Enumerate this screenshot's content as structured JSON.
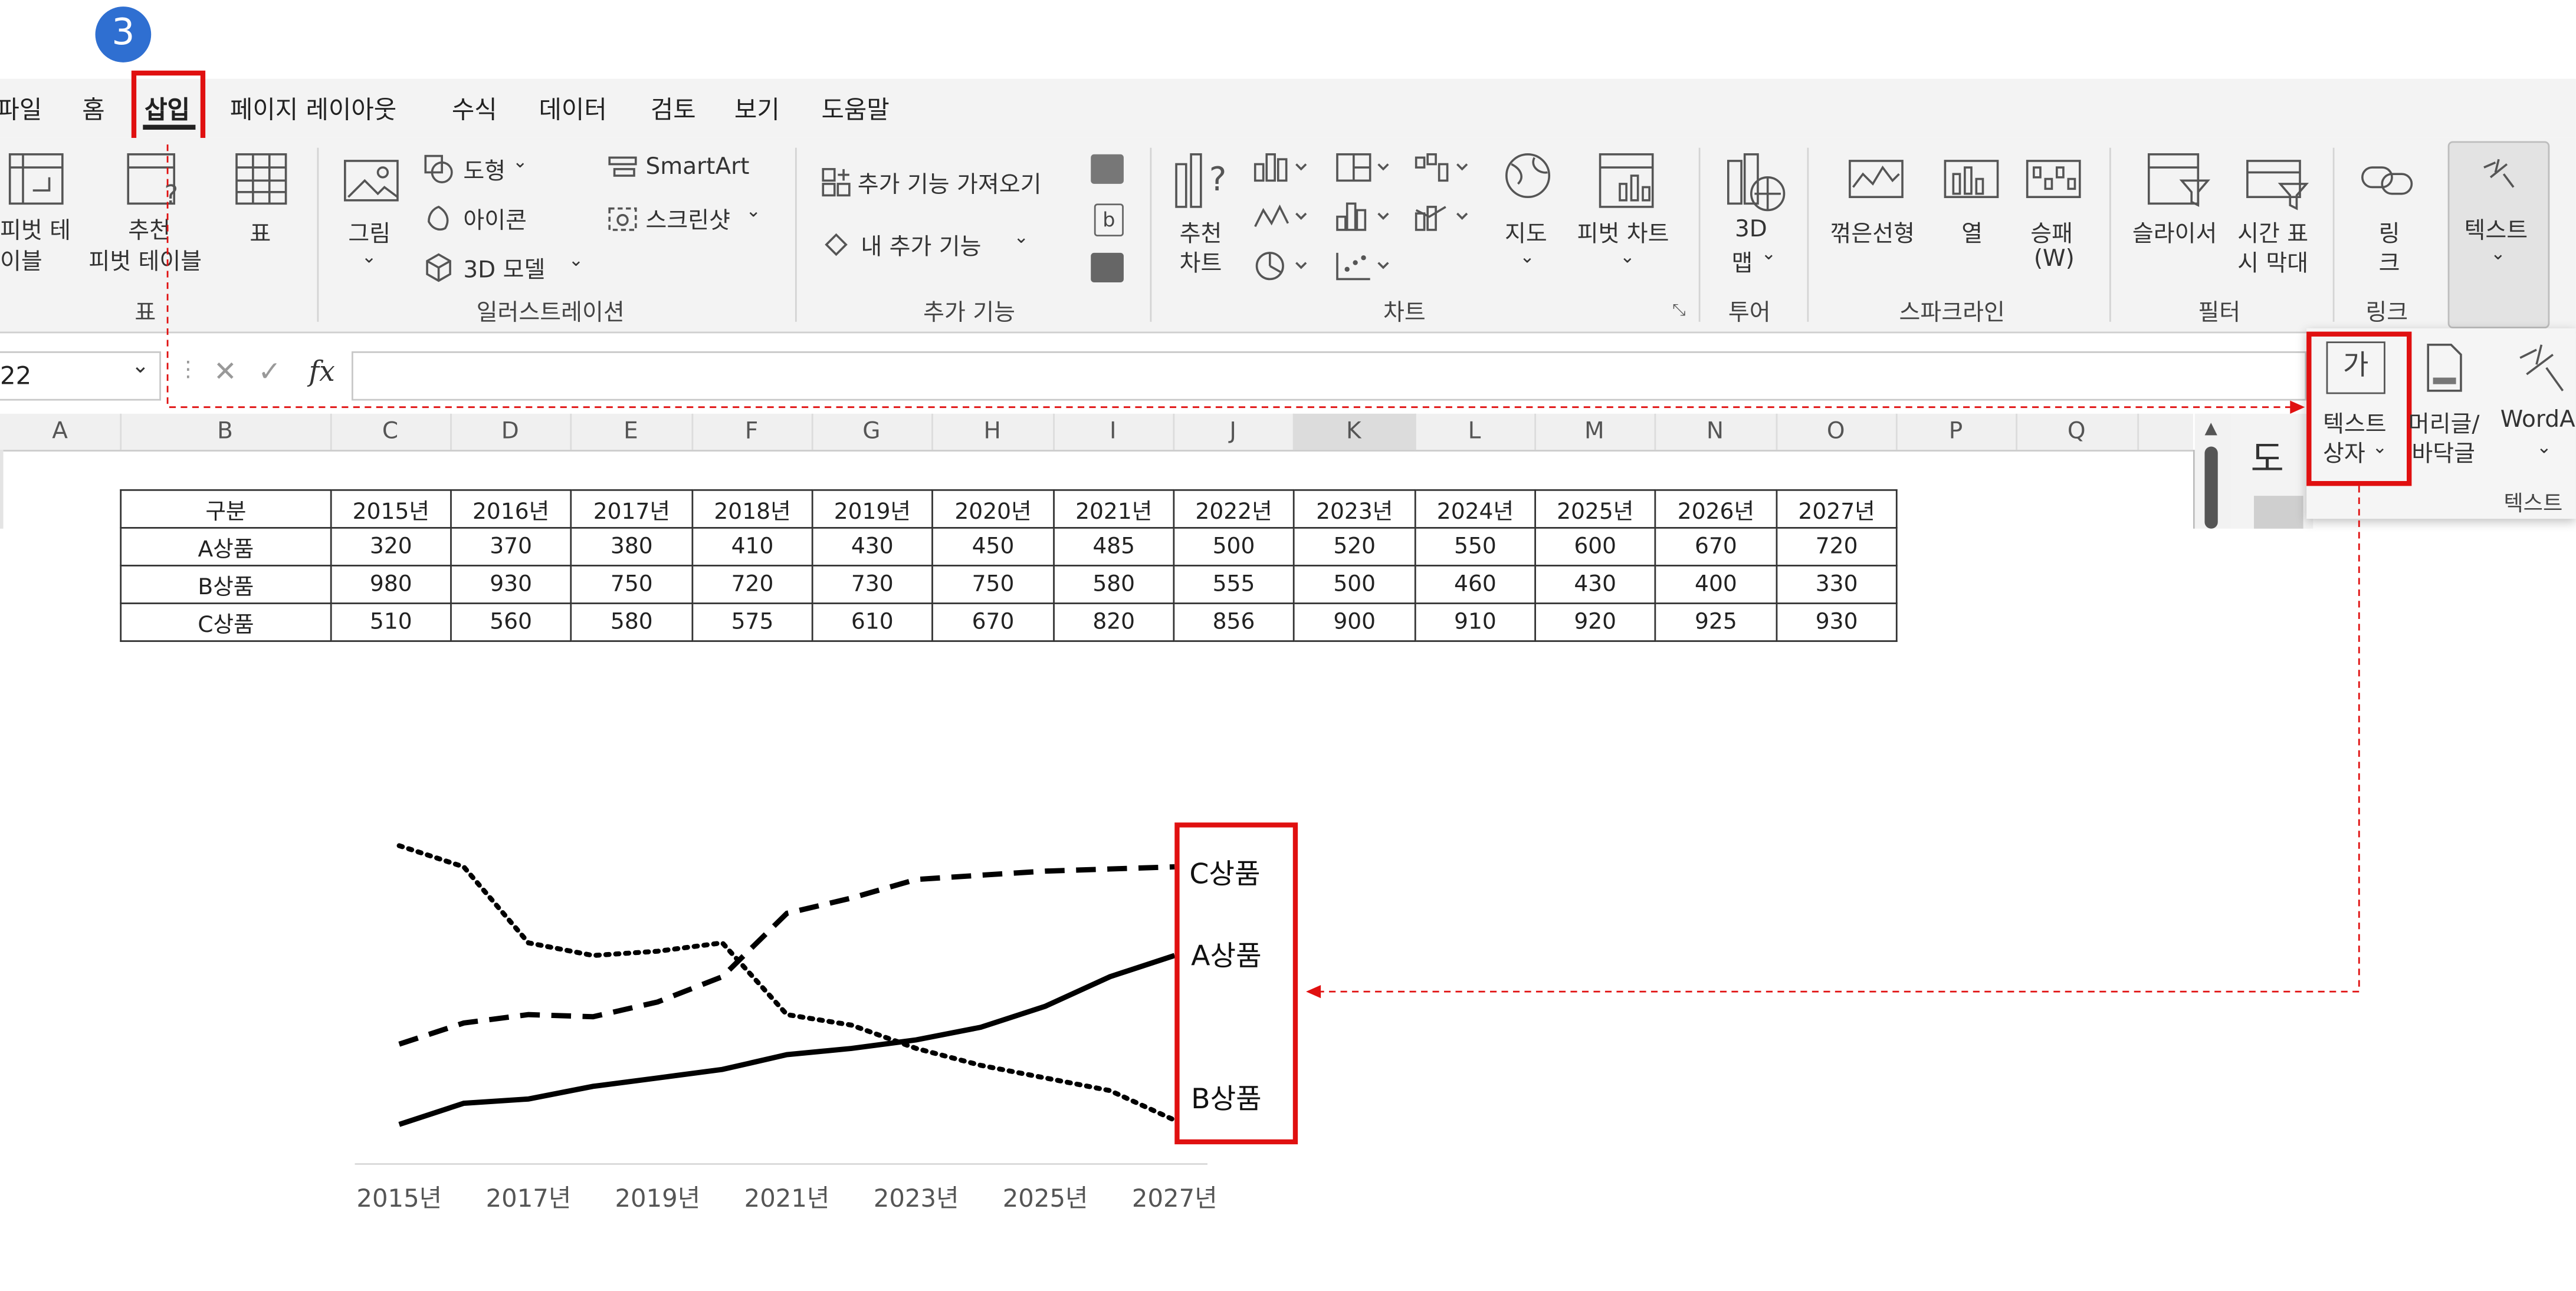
{
  "step_badge": "3",
  "menu": {
    "tabs": [
      "파일",
      "홈",
      "삽입",
      "페이지 레이아웃",
      "수식",
      "데이터",
      "검토",
      "보기",
      "도움말"
    ],
    "active_tab": "삽입"
  },
  "ribbon": {
    "tables": {
      "pivot_table_line1": "피벗 테",
      "pivot_table_line2": "이블",
      "recommended_line1": "추천",
      "recommended_line2": "피벗 테이블",
      "table": "표",
      "group": "표"
    },
    "illustrations": {
      "pictures": "그림",
      "shapes": "도형",
      "icons": "아이콘",
      "models3d": "3D 모델",
      "smartart": "SmartArt",
      "screenshot": "스크린샷",
      "group": "일러스트레이션"
    },
    "addins": {
      "get": "추가 기능 가져오기",
      "my": "내 추가 기능",
      "group": "추가 기능"
    },
    "charts": {
      "recommended_line1": "추천",
      "recommended_line2": "차트",
      "maps": "지도",
      "pivot_chart": "피벗 차트",
      "group": "차트"
    },
    "tours": {
      "map3d_line1": "3D",
      "map3d_line2": "맵",
      "group": "투어"
    },
    "sparklines": {
      "line": "꺾은선형",
      "column": "열",
      "winloss_line1": "승패",
      "winloss_line2": "(W)",
      "group": "스파크라인"
    },
    "filters": {
      "slicer": "슬라이서",
      "timeline_line1": "시간 표",
      "timeline_line2": "시 막대",
      "group": "필터"
    },
    "links": {
      "link_line1": "링",
      "link_line2": "크",
      "group": "링크"
    },
    "text": {
      "label": "텍스트"
    }
  },
  "text_dropdown": {
    "textbox_icon_glyph": "가",
    "textbox_line1": "텍스트",
    "textbox_line2": "상자",
    "header_line1": "머리글/",
    "header_line2": "바닥글",
    "wordart": "WordA",
    "group": "텍스트"
  },
  "side_panel_partial": "도",
  "formula_bar": {
    "name_box": "22",
    "fx": "fx"
  },
  "columns": [
    "A",
    "B",
    "C",
    "D",
    "E",
    "F",
    "G",
    "H",
    "I",
    "J",
    "K",
    "L",
    "M",
    "N",
    "O",
    "P",
    "Q"
  ],
  "table": {
    "header": [
      "구분",
      "2015년",
      "2016년",
      "2017년",
      "2018년",
      "2019년",
      "2020년",
      "2021년",
      "2022년",
      "2023년",
      "2024년",
      "2025년",
      "2026년",
      "2027년"
    ],
    "rows": [
      [
        "A상품",
        "320",
        "370",
        "380",
        "410",
        "430",
        "450",
        "485",
        "500",
        "520",
        "550",
        "600",
        "670",
        "720"
      ],
      [
        "B상품",
        "980",
        "930",
        "750",
        "720",
        "730",
        "750",
        "580",
        "555",
        "500",
        "460",
        "430",
        "400",
        "330"
      ],
      [
        "C상품",
        "510",
        "560",
        "580",
        "575",
        "610",
        "670",
        "820",
        "856",
        "900",
        "910",
        "920",
        "925",
        "930"
      ]
    ]
  },
  "chart_data": {
    "type": "line",
    "x": [
      "2015년",
      "2016년",
      "2017년",
      "2018년",
      "2019년",
      "2020년",
      "2021년",
      "2022년",
      "2023년",
      "2024년",
      "2025년",
      "2026년",
      "2027년"
    ],
    "tick_labels": [
      "2015년",
      "2017년",
      "2019년",
      "2021년",
      "2023년",
      "2025년",
      "2027년"
    ],
    "series": [
      {
        "name": "A상품",
        "style": "solid",
        "values": [
          320,
          370,
          380,
          410,
          430,
          450,
          485,
          500,
          520,
          550,
          600,
          670,
          720
        ]
      },
      {
        "name": "B상품",
        "style": "dotted",
        "values": [
          980,
          930,
          750,
          720,
          730,
          750,
          580,
          555,
          500,
          460,
          430,
          400,
          330
        ]
      },
      {
        "name": "C상품",
        "style": "dashed",
        "values": [
          510,
          560,
          580,
          575,
          610,
          670,
          820,
          856,
          900,
          910,
          920,
          925,
          930
        ]
      }
    ],
    "ylim": [
      300,
      1000
    ],
    "grid": false,
    "legend": "right, boxed text labels",
    "title": "",
    "xlabel": "",
    "ylabel": ""
  },
  "colors": {
    "highlight": "#e01010",
    "badge": "#2f6fd1",
    "ribbon_bg": "#f3f3f3"
  }
}
